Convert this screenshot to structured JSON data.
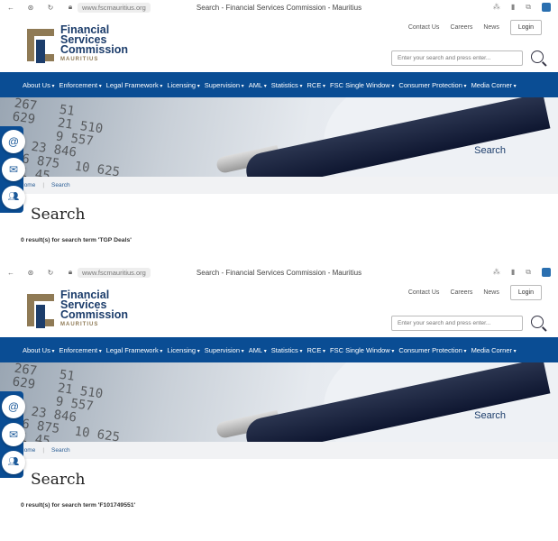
{
  "panels": [
    {
      "browser": {
        "url": "www.fscmauritius.org",
        "title": "Search - Financial Services Commission - Mauritius"
      },
      "result_text": "0 result(s) for search term 'TGP Deals'"
    },
    {
      "browser": {
        "url": "www.fscmauritius.org",
        "title": "Search - Financial Services Commission - Mauritius"
      },
      "result_text": "0 result(s) for search term 'F101749551'"
    }
  ],
  "logo": {
    "line1": "Financial",
    "line2": "Services",
    "line3": "Commission",
    "line4": "MAURITIUS"
  },
  "top_links": [
    "Contact Us",
    "Careers",
    "News"
  ],
  "login_label": "Login",
  "search_placeholder": "Enter your search and press enter...",
  "nav": [
    "About Us",
    "Enforcement",
    "Legal Framework",
    "Licensing",
    "Supervision",
    "AML",
    "Statistics",
    "RCE",
    "FSC Single Window",
    "Consumer Protection",
    "Media Corner"
  ],
  "hero_title": "Search",
  "hero_numbers": "267   51\n629   21 510\n      9 557\n   23 846\n  6 875  10 625\n 51 45",
  "breadcrumb": {
    "home": "Home",
    "current": "Search"
  },
  "page_title": "Search",
  "colors": {
    "nav": "#0a4d94",
    "brand_blue": "#1c3d6b",
    "brand_gold": "#8f7a55"
  }
}
